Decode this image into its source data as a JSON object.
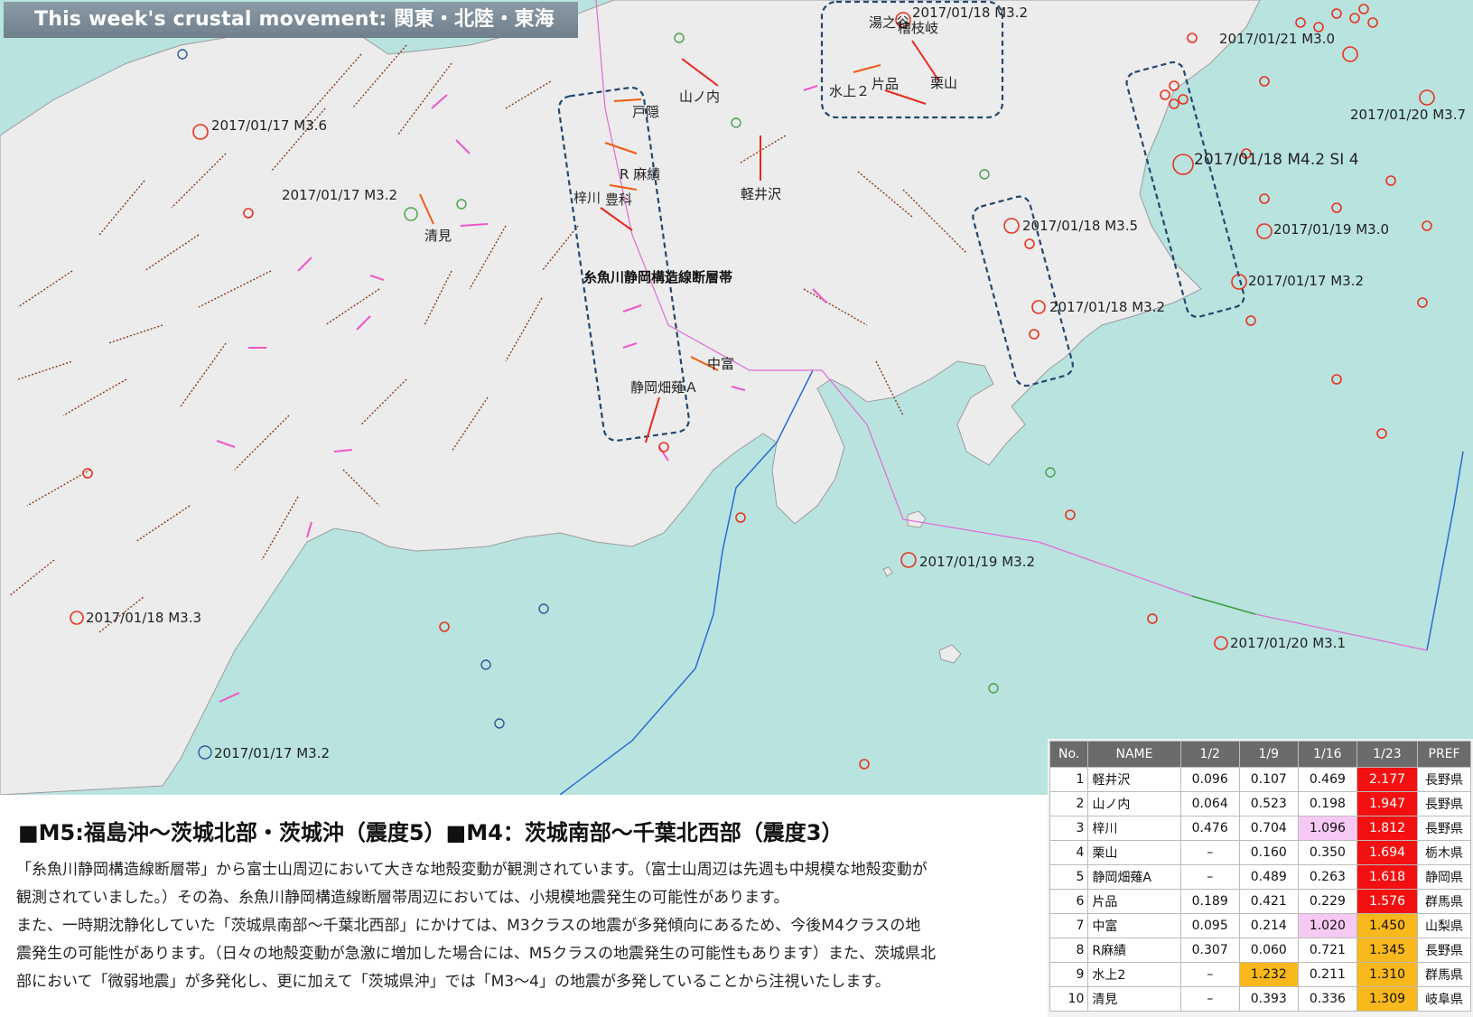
{
  "title": "This week's crustal movement: 関東・北陸・東海",
  "fault_zone_label": "糸魚川静岡構造線断層帯",
  "stations": [
    {
      "name": "戸隠"
    },
    {
      "name": "山ノ内"
    },
    {
      "name": "R 麻績"
    },
    {
      "name": "梓川"
    },
    {
      "name": "豊科"
    },
    {
      "name": "清見"
    },
    {
      "name": "軽井沢"
    },
    {
      "name": "中富"
    },
    {
      "name": "静岡畑薙Ａ"
    },
    {
      "name": "湯之谷"
    },
    {
      "name": "檜枝岐"
    },
    {
      "name": "水上２"
    },
    {
      "name": "片品"
    },
    {
      "name": "栗山"
    }
  ],
  "earthquakes": [
    {
      "label": "2017/01/18 M3.2"
    },
    {
      "label": "2017/01/21 M3.0"
    },
    {
      "label": "2017/01/20 M3.7"
    },
    {
      "label": "2017/01/17 M3.6"
    },
    {
      "label": "2017/01/18 M4.2 SI 4"
    },
    {
      "label": "2017/01/17 M3.2"
    },
    {
      "label": "2017/01/18 M3.5"
    },
    {
      "label": "2017/01/19 M3.0"
    },
    {
      "label": "2017/01/17 M3.2"
    },
    {
      "label": "2017/01/18 M3.2"
    },
    {
      "label": "2017/01/19 M3.2"
    },
    {
      "label": "2017/01/18 M3.3"
    },
    {
      "label": "2017/01/20 M3.1"
    },
    {
      "label": "2017/01/17 M3.2"
    }
  ],
  "headline": "■M5:福島沖～茨城北部・茨城沖（震度5）■M4：茨城南部～千葉北西部（震度3）",
  "paragraph_lines": [
    "「糸魚川静岡構造線断層帯」から富士山周辺において大きな地殻変動が観測されています。（富士山周辺は先週も中規模な地殻変動が",
    "観測されていました。）その為、糸魚川静岡構造線断層帯周辺においては、小規模地震発生の可能性があります。",
    "また、一時期沈静化していた「茨城県南部～千葉北西部」にかけては、M3クラスの地震が多発傾向にあるため、今後M4クラスの地",
    "震発生の可能性があります。（日々の地殻変動が急激に増加した場合には、M5クラスの地震発生の可能性もあります）また、茨城県北",
    "部において「微弱地震」が多発化し、更に加えて「茨城県沖」では「M3～4」の地震が多発していることから注視いたします。"
  ],
  "table": {
    "headers": [
      "No.",
      "NAME",
      "1/2",
      "1/9",
      "1/16",
      "1/23",
      "PREF"
    ],
    "rows": [
      {
        "no": "1",
        "name": "軽井沢",
        "v1": "0.096",
        "v2": "0.107",
        "v3": "0.469",
        "v4": "2.177",
        "pref": "長野県",
        "hl": [
          "",
          "",
          "",
          "red"
        ]
      },
      {
        "no": "2",
        "name": "山ノ内",
        "v1": "0.064",
        "v2": "0.523",
        "v3": "0.198",
        "v4": "1.947",
        "pref": "長野県",
        "hl": [
          "",
          "",
          "",
          "red"
        ]
      },
      {
        "no": "3",
        "name": "梓川",
        "v1": "0.476",
        "v2": "0.704",
        "v3": "1.096",
        "v4": "1.812",
        "pref": "長野県",
        "hl": [
          "",
          "",
          "pink",
          "red"
        ]
      },
      {
        "no": "4",
        "name": "栗山",
        "v1": "–",
        "v2": "0.160",
        "v3": "0.350",
        "v4": "1.694",
        "pref": "栃木県",
        "hl": [
          "",
          "",
          "",
          "red"
        ]
      },
      {
        "no": "5",
        "name": "静岡畑薙A",
        "v1": "–",
        "v2": "0.489",
        "v3": "0.263",
        "v4": "1.618",
        "pref": "静岡県",
        "hl": [
          "",
          "",
          "",
          "red"
        ]
      },
      {
        "no": "6",
        "name": "片品",
        "v1": "0.189",
        "v2": "0.421",
        "v3": "0.229",
        "v4": "1.576",
        "pref": "群馬県",
        "hl": [
          "",
          "",
          "",
          "red"
        ]
      },
      {
        "no": "7",
        "name": "中富",
        "v1": "0.095",
        "v2": "0.214",
        "v3": "1.020",
        "v4": "1.450",
        "pref": "山梨県",
        "hl": [
          "",
          "",
          "pink",
          "ora"
        ]
      },
      {
        "no": "8",
        "name": "R麻績",
        "v1": "0.307",
        "v2": "0.060",
        "v3": "0.721",
        "v4": "1.345",
        "pref": "長野県",
        "hl": [
          "",
          "",
          "",
          "ora"
        ]
      },
      {
        "no": "9",
        "name": "水上2",
        "v1": "–",
        "v2": "1.232",
        "v3": "0.211",
        "v4": "1.310",
        "pref": "群馬県",
        "hl": [
          "",
          "ora",
          "",
          "ora"
        ]
      },
      {
        "no": "10",
        "name": "清見",
        "v1": "–",
        "v2": "0.393",
        "v3": "0.336",
        "v4": "1.309",
        "pref": "岐阜県",
        "hl": [
          "",
          "",
          "",
          "ora"
        ]
      }
    ]
  },
  "colors": {
    "sea": "#b9e3df",
    "land": "#ececec",
    "quake": "#e8321e",
    "fault": "#8a3a12",
    "arrow_red": "#e8281a",
    "arrow_pink": "#ee55cc",
    "zone": "#23476e"
  }
}
